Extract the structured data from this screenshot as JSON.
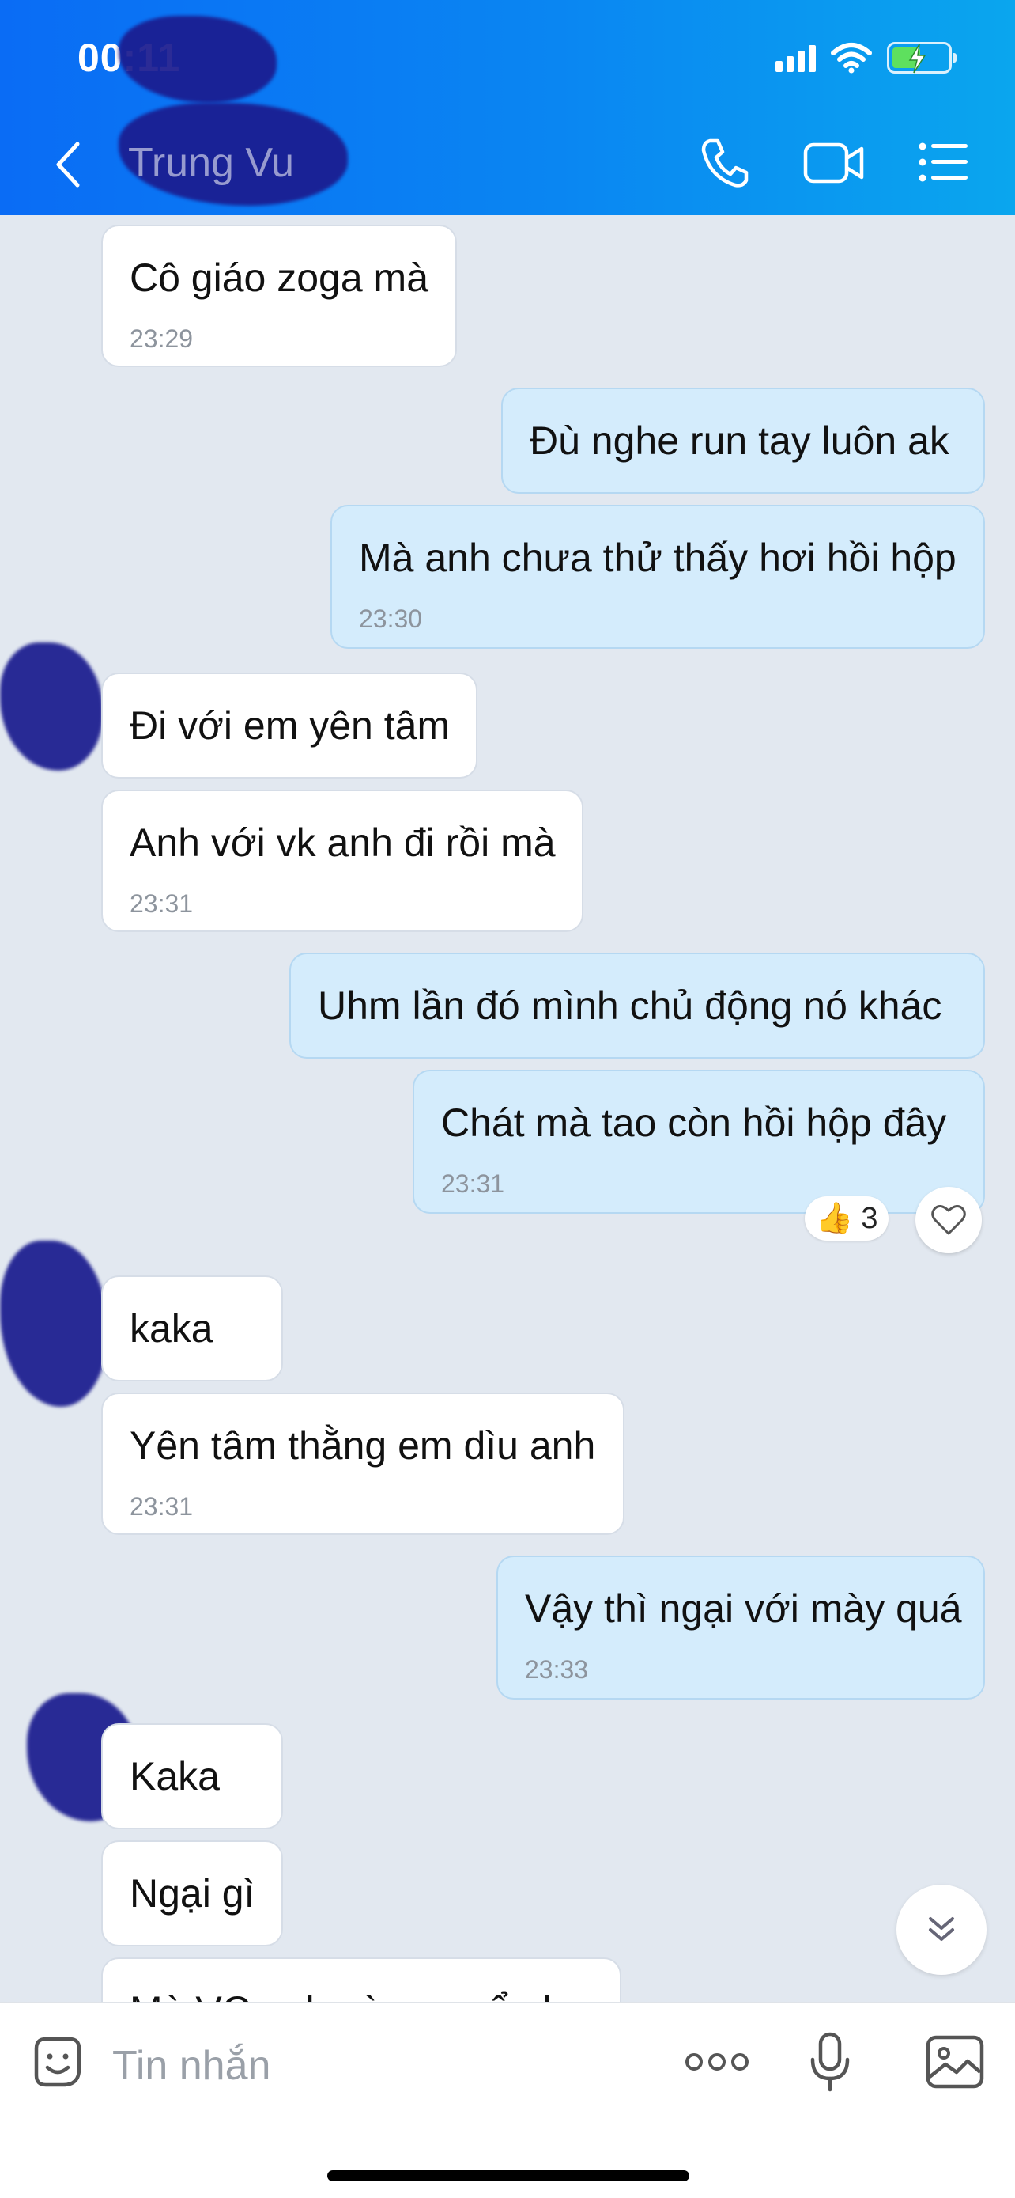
{
  "status_bar": {
    "time": "00:11"
  },
  "header": {
    "contact_name": "Trung Vu"
  },
  "messages": [
    {
      "text": "Cô giáo zoga mà",
      "time": "23:29"
    },
    {
      "text": "Đù nghe run tay luôn ak"
    },
    {
      "text": "Mà anh chưa thử thấy hơi hồi hộp",
      "time": "23:30"
    },
    {
      "text": "Đi với em yên tâm"
    },
    {
      "text": "Anh với vk anh đi rồi mà",
      "time": "23:31"
    },
    {
      "text": "Uhm lần đó mình chủ động nó khác"
    },
    {
      "text": "Chát mà tao còn hồi hộp đây",
      "time": "23:31",
      "reaction": {
        "emoji": "👍",
        "count": "3"
      }
    },
    {
      "text": "kaka"
    },
    {
      "text": "Yên tâm thằng em dìu anh",
      "time": "23:31"
    },
    {
      "text": "Vậy thì ngại với mày quá",
      "time": "23:33"
    },
    {
      "text": "Kaka"
    },
    {
      "text": "Ngại gì"
    },
    {
      "text": "Mà VC anh này sao ổn ko"
    }
  ],
  "input": {
    "placeholder": "Tin nhắn"
  },
  "colors": {
    "header_start": "#0a6cf5",
    "header_end": "#0aa6ee",
    "outgoing_bubble": "#d4ecfc",
    "incoming_bubble": "#ffffff"
  },
  "icons": [
    "back-arrow-icon",
    "phone-icon",
    "video-camera-icon",
    "list-menu-icon",
    "sticker-icon",
    "more-dots-icon",
    "microphone-icon",
    "image-icon",
    "heart-icon",
    "chevron-double-down-icon"
  ]
}
